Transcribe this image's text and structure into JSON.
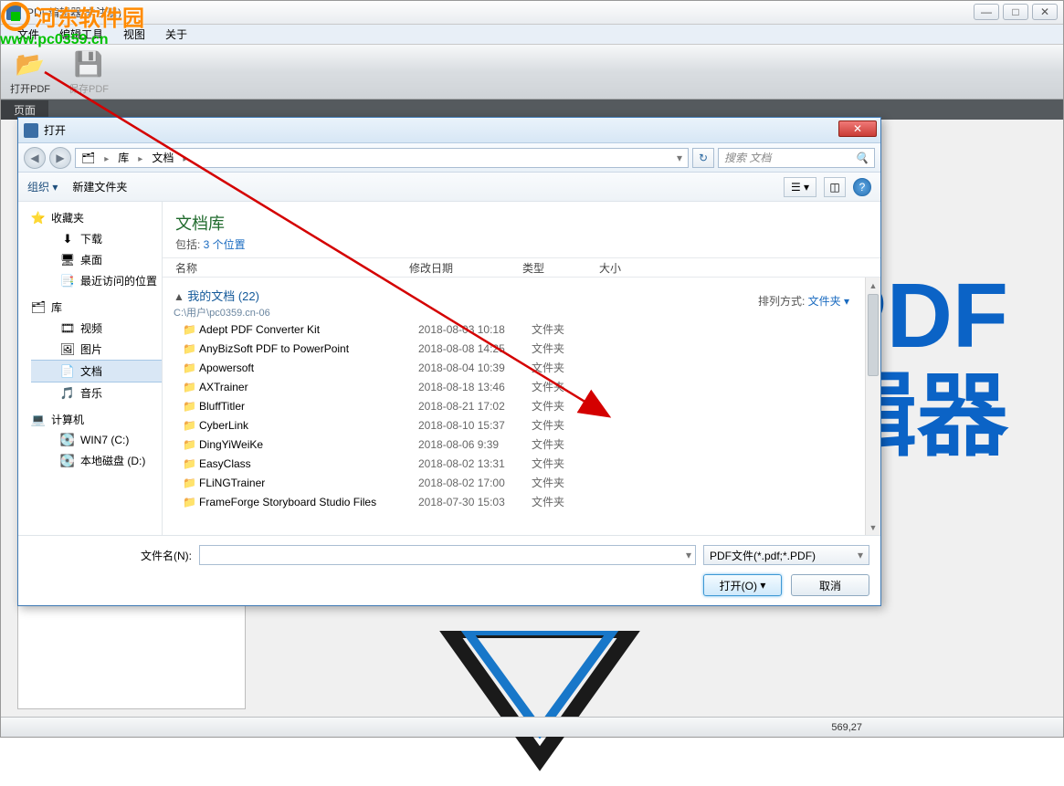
{
  "main": {
    "title": "PDF编辑器(未注册)",
    "menu": [
      "文件",
      "编辑工具",
      "视图",
      "关于"
    ],
    "tools": {
      "open": "打开PDF",
      "save": "保存PDF"
    },
    "tab": "页面",
    "status": "569,27"
  },
  "watermark": {
    "name": "河东软件园",
    "url": "www.pc0359.cn"
  },
  "bg": {
    "line1": "PDF",
    "line2": "辑器"
  },
  "dialog": {
    "title": "打开",
    "breadcrumb": [
      "库",
      "文档"
    ],
    "search_placeholder": "搜索 文档",
    "toolbar": {
      "organize": "组织 ▾",
      "newfolder": "新建文件夹"
    },
    "nav": {
      "fav": "收藏夹",
      "fav_items": [
        {
          "icon": "⬇",
          "label": "下载"
        },
        {
          "icon": "🖥",
          "label": "桌面"
        },
        {
          "icon": "📑",
          "label": "最近访问的位置"
        }
      ],
      "lib": "库",
      "lib_items": [
        {
          "icon": "🎞",
          "label": "视频"
        },
        {
          "icon": "🖼",
          "label": "图片"
        },
        {
          "icon": "📄",
          "label": "文档",
          "selected": true
        },
        {
          "icon": "🎵",
          "label": "音乐"
        }
      ],
      "comp": "计算机",
      "comp_items": [
        {
          "icon": "💽",
          "label": "WIN7 (C:)"
        },
        {
          "icon": "💽",
          "label": "本地磁盘 (D:)"
        }
      ]
    },
    "lib_title": "文档库",
    "lib_sub_prefix": "包括: ",
    "lib_sub_link": "3 个位置",
    "arrange": {
      "label": "排列方式:",
      "value": "文件夹 ▾"
    },
    "columns": [
      "名称",
      "修改日期",
      "类型",
      "大小"
    ],
    "group": {
      "name": "我的文档 (22)",
      "path": "C:\\用户\\pc0359.cn-06"
    },
    "files": [
      {
        "name": "Adept PDF Converter Kit",
        "date": "2018-08-03 10:18",
        "type": "文件夹"
      },
      {
        "name": "AnyBizSoft PDF to PowerPoint",
        "date": "2018-08-08 14:25",
        "type": "文件夹"
      },
      {
        "name": "Apowersoft",
        "date": "2018-08-04 10:39",
        "type": "文件夹"
      },
      {
        "name": "AXTrainer",
        "date": "2018-08-18 13:46",
        "type": "文件夹"
      },
      {
        "name": "BluffTitler",
        "date": "2018-08-21 17:02",
        "type": "文件夹"
      },
      {
        "name": "CyberLink",
        "date": "2018-08-10 15:37",
        "type": "文件夹"
      },
      {
        "name": "DingYiWeiKe",
        "date": "2018-08-06 9:39",
        "type": "文件夹"
      },
      {
        "name": "EasyClass",
        "date": "2018-08-02 13:31",
        "type": "文件夹"
      },
      {
        "name": "FLiNGTrainer",
        "date": "2018-08-02 17:00",
        "type": "文件夹"
      },
      {
        "name": "FrameForge Storyboard Studio Files",
        "date": "2018-07-30 15:03",
        "type": "文件夹"
      }
    ],
    "filename_label": "文件名(N):",
    "filetype": "PDF文件(*.pdf;*.PDF)",
    "btn_open": "打开(O)",
    "btn_cancel": "取消"
  }
}
